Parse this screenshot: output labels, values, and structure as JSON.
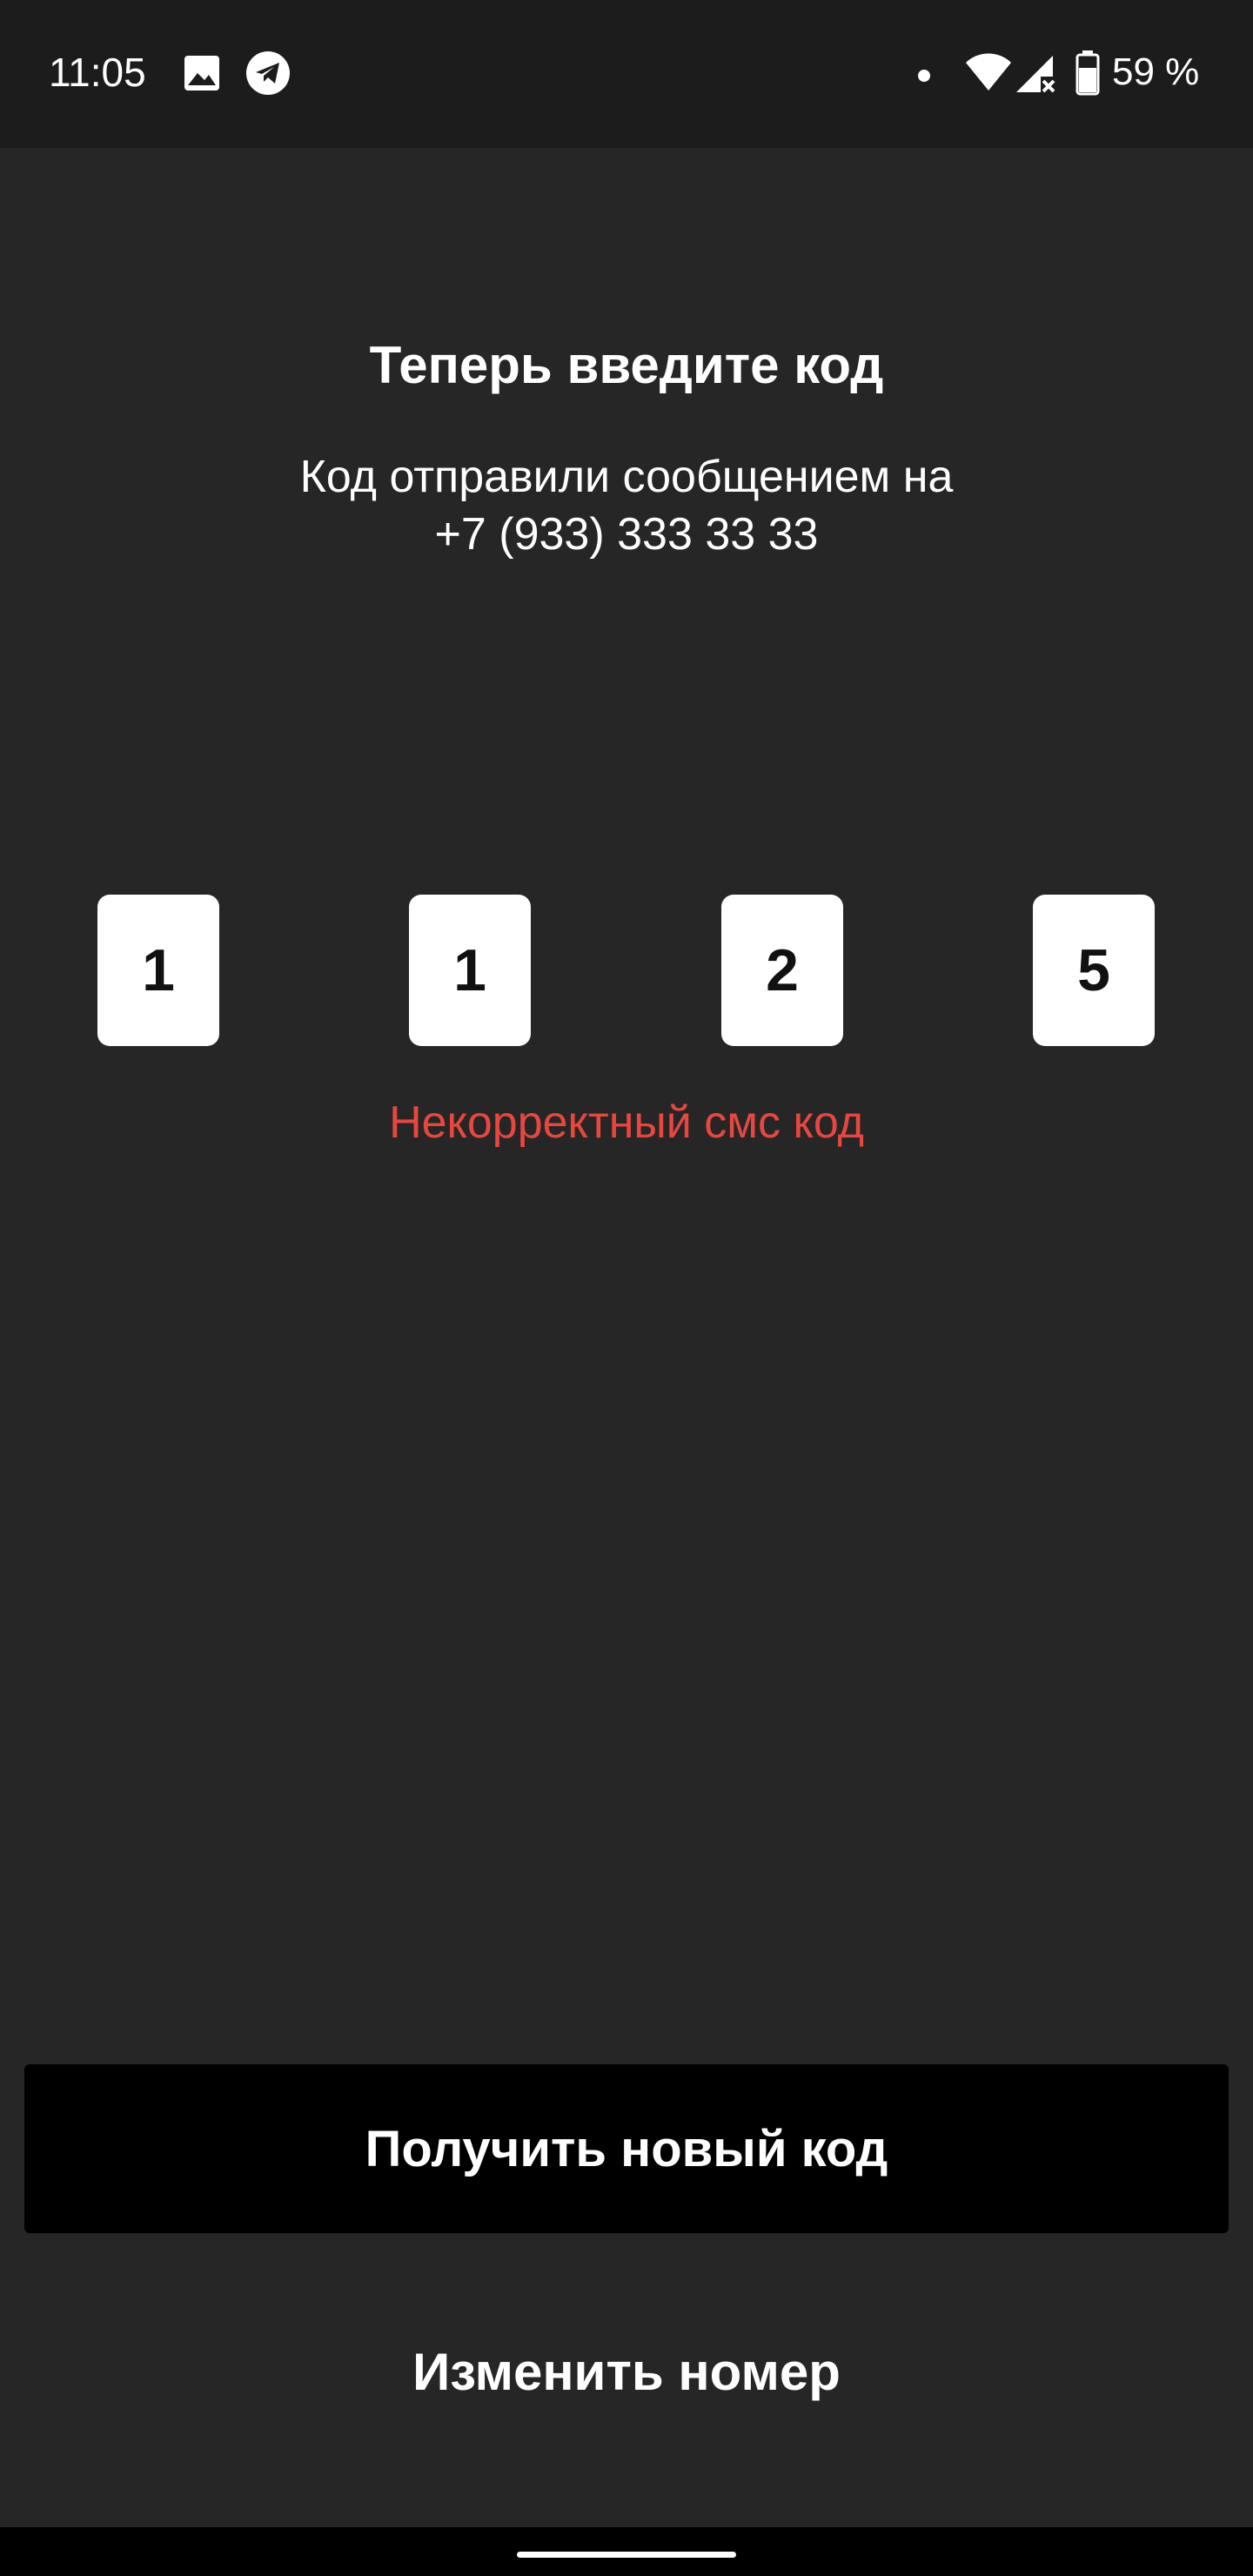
{
  "status_bar": {
    "time": "11:05",
    "icons": [
      "image-icon",
      "telegram-icon",
      "notification-dot-icon",
      "wifi-icon",
      "cellular-no-signal-icon",
      "battery-icon"
    ],
    "battery_text": "59 %"
  },
  "screen": {
    "title": "Теперь введите код",
    "subtitle_line1": "Код отправили сообщением на",
    "subtitle_line2": "+7 (933) 333 33 33",
    "code_digits": [
      "1",
      "1",
      "2",
      "5"
    ],
    "error_text": "Некорректный смс код",
    "get_new_code_label": "Получить новый код",
    "change_number_label": "Изменить номер"
  },
  "colors": {
    "background": "#262626",
    "status_bar": "#1c1c1c",
    "error": "#e8473f",
    "primary_button": "#000000",
    "code_box": "#ffffff"
  }
}
